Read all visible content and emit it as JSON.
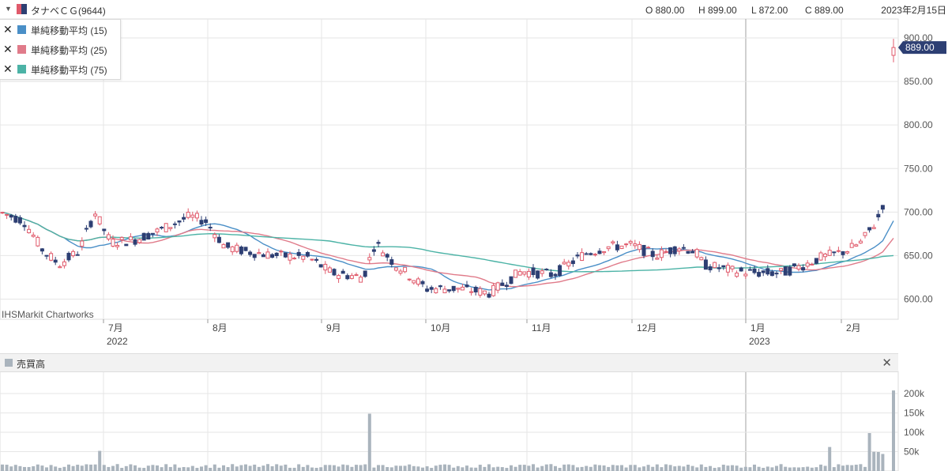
{
  "header": {
    "symbol": "タナベＣＧ(9644)",
    "open": "O 880.00",
    "high": "H 899.00",
    "low": "L 872.00",
    "close": "C 889.00",
    "date": "2023年2月15日"
  },
  "legend": [
    {
      "label": "単純移動平均 (15)",
      "color": "#4a8fc7"
    },
    {
      "label": "単純移動平均 (25)",
      "color": "#e07b8a"
    },
    {
      "label": "単純移動平均 (75)",
      "color": "#4cb3a6"
    }
  ],
  "watermark": "IHSMarkit Chartworks",
  "last_price_label": "889.00",
  "volume_panel": {
    "label": "売買高",
    "close_icon": "close-icon"
  },
  "colors": {
    "up": "#e05a6b",
    "down": "#2d3f73",
    "volume": "#aab4bd",
    "grid": "#e6e6e6",
    "price_tag": "#2d3f73"
  },
  "chart_data": [
    {
      "type": "candlestick",
      "title": "タナベＣＧ(9644)",
      "x_tick_labels": [
        "7月",
        "8月",
        "9月",
        "10月",
        "11月",
        "12月",
        "1月",
        "2月"
      ],
      "x_year_labels": [
        "2022",
        "2023"
      ],
      "y_ticks": [
        "600.00",
        "650.00",
        "700.00",
        "750.00",
        "800.00",
        "850.00",
        "900.00"
      ],
      "ylim": [
        585,
        905
      ],
      "series": [
        {
          "name": "単純移動平均 (15)",
          "kind": "line"
        },
        {
          "name": "単純移動平均 (25)",
          "kind": "line"
        },
        {
          "name": "単純移動平均 (75)",
          "kind": "line"
        }
      ],
      "last": {
        "open": 880,
        "high": 899,
        "low": 872,
        "close": 889
      },
      "period": {
        "start": "2022-06",
        "end": "2023-02-15"
      }
    },
    {
      "type": "bar",
      "title": "売買高",
      "y_ticks": [
        "50k",
        "100k",
        "150k",
        "200k"
      ],
      "ylim": [
        0,
        215000
      ]
    }
  ]
}
